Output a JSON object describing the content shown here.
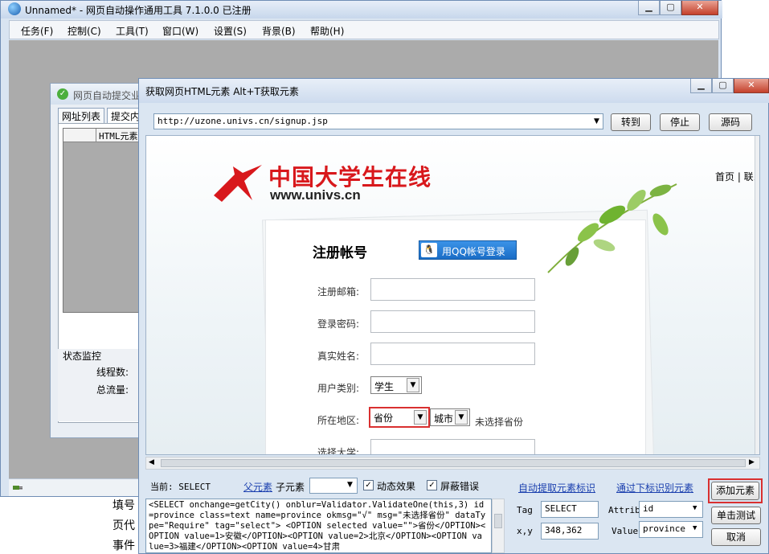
{
  "main_window": {
    "title": "Unnamed* - 网页自动操作通用工具 7.1.0.0  已注册",
    "menu": [
      "任务(F)",
      "控制(C)",
      "工具(T)",
      "窗口(W)",
      "设置(S)",
      "背景(B)",
      "帮助(H)"
    ]
  },
  "sub_window": {
    "title": "网页自动提交业",
    "tabs": [
      "网址列表",
      "提交内"
    ],
    "grid_header": "HTML元素",
    "status_header": "状态监控",
    "status_items": [
      "线程数:",
      "总流量:"
    ]
  },
  "background_text": [
    "填号",
    "页代",
    "事件"
  ],
  "dialog": {
    "title": "获取网页HTML元素  Alt+T获取元素",
    "url": "http://uzone.univs.cn/signup.jsp",
    "buttons": {
      "goto": "转到",
      "stop": "停止",
      "source": "源码"
    },
    "page": {
      "site_name": "中国大学生在线",
      "site_url": "www.univs.cn",
      "top_links": "首页  |  联系",
      "reg_title": "注册帐号",
      "qq_login": "用QQ帐号登录",
      "fields": [
        "注册邮箱:",
        "登录密码:",
        "真实姓名:",
        "用户类别:",
        "所在地区:",
        "选择大学:"
      ],
      "user_type": "学生",
      "province": "省份",
      "city": "城市",
      "province_hint": "未选择省份"
    },
    "current_label": "当前: SELECT",
    "parent_link": "父元素",
    "child_label": "子元素",
    "dynamic_effect": "动态效果",
    "block_errors": "屏蔽错误",
    "auto_extract_link": "自动提取元素标识",
    "subscript_link": "通过下标识别元素",
    "code": "<SELECT onchange=getCity() onblur=Validator.ValidateOne(this,3) id=province class=text name=province okmsg=\"√\" msg=\"未选择省份\" dataType=\"Require\" tag=\"select\"> <OPTION selected value=\"\">省份</OPTION><OPTION value=1>安徽</OPTION><OPTION value=2>北京</OPTION><OPTION value=3>福建</OPTION><OPTION value=4>甘肃",
    "tag_label": "Tag",
    "tag_value": "SELECT",
    "xy_label": "x,y",
    "xy_value": "348,362",
    "attrib_label": "Attrib",
    "attrib_value": "id",
    "value_label": "Value",
    "value_value": "province",
    "add_element": "添加元素",
    "click_test": "单击测试",
    "cancel": "取消"
  },
  "colors": {
    "highlight": "#d93030",
    "logo_red": "#d8181c",
    "link": "#1a3fae"
  }
}
